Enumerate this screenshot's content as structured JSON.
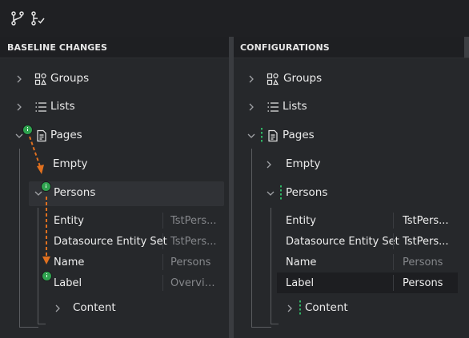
{
  "toolbar": {
    "icons": [
      "branch-icon",
      "branch-check-icon"
    ]
  },
  "left_panel": {
    "title": "BASELINE CHANGES",
    "tree": {
      "groups": "Groups",
      "lists": "Lists",
      "pages": "Pages",
      "empty": "Empty",
      "persons": "Persons",
      "content": "Content"
    },
    "props": [
      {
        "key": "Entity",
        "value": "TstPers..."
      },
      {
        "key": "Datasource Entity Set",
        "value": "TstPers..."
      },
      {
        "key": "Name",
        "value": "Persons"
      },
      {
        "key": "Label",
        "value": "Overvie..."
      }
    ]
  },
  "right_panel": {
    "title": "CONFIGURATIONS",
    "tree": {
      "groups": "Groups",
      "lists": "Lists",
      "pages": "Pages",
      "empty": "Empty",
      "persons": "Persons",
      "content": "Content"
    },
    "props": [
      {
        "key": "Entity",
        "value": "TstPers..."
      },
      {
        "key": "Datasource Entity Set",
        "value": "TstPers..."
      },
      {
        "key": "Name",
        "value": "Persons"
      },
      {
        "key": "Label",
        "value": "Persons"
      }
    ]
  },
  "colors": {
    "accent_orange": "#e0701f",
    "badge_green": "#2fa34f",
    "dot_green": "#2fb564"
  }
}
